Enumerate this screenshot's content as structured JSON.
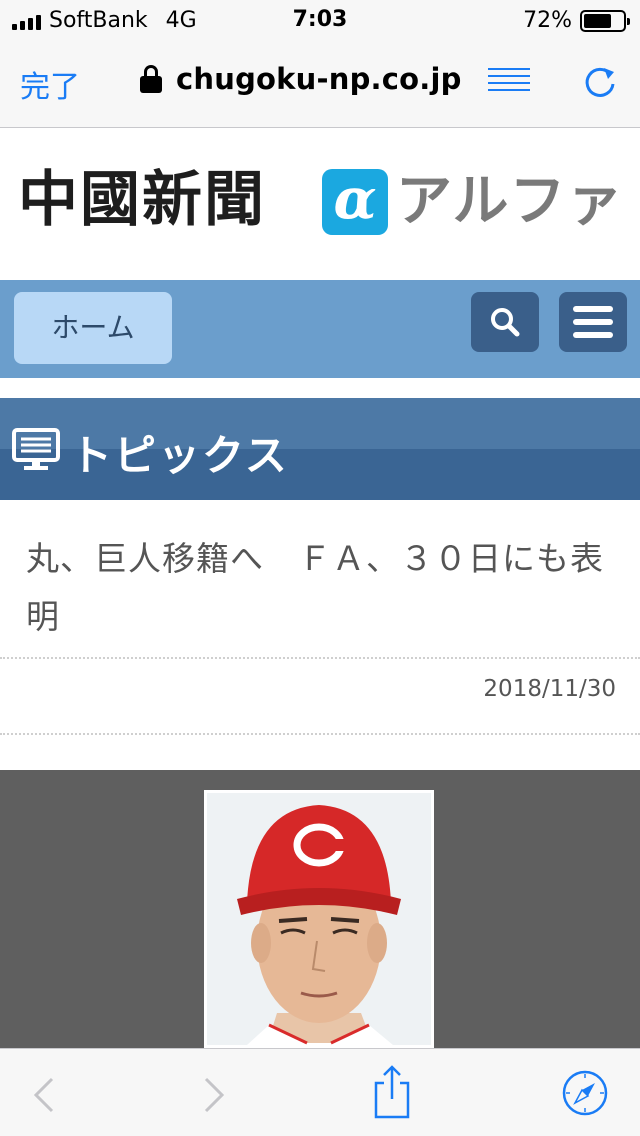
{
  "status_bar": {
    "carrier": "SoftBank",
    "network": "4G",
    "time": "7:03",
    "battery_percent": "72%",
    "battery_level": 0.72
  },
  "browser": {
    "done_label": "完了",
    "url": "chugoku-np.co.jp",
    "accent_color": "#1a7cf5"
  },
  "logo": {
    "kanji": "中國新聞",
    "alpha": "α",
    "katakana": "アルファ"
  },
  "nav": {
    "home_label": "ホーム"
  },
  "section": {
    "title": "トピックス"
  },
  "article": {
    "title": "丸、巨人移籍へ　ＦＡ、３０日にも表明",
    "date": "2018/11/30"
  },
  "toolbar": {
    "icons": [
      "back-icon",
      "forward-icon",
      "share-icon",
      "compass-icon"
    ]
  },
  "colors": {
    "nav_bar": "#6b9ecc",
    "home_button": "#b8d8f6",
    "nav_icon_button": "#3a5f8a",
    "section_header": "#4d79a6",
    "photo_background": "#5f5f5f"
  }
}
